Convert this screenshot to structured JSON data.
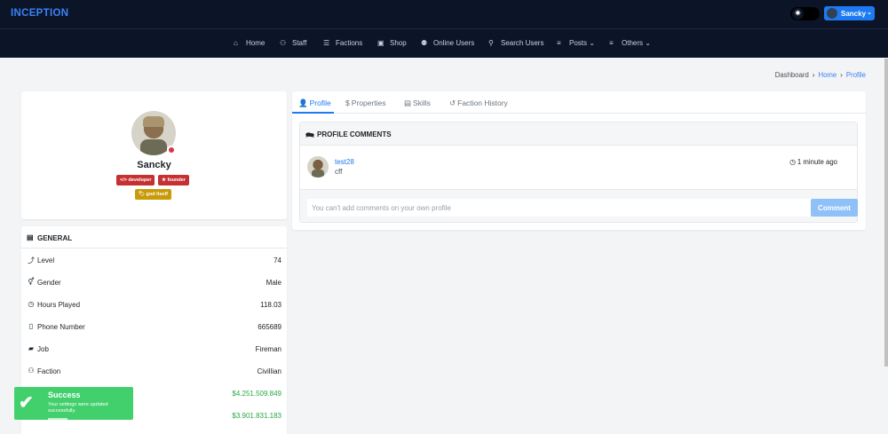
{
  "brand": "INCEPTION",
  "user_menu": {
    "name": "Sancky",
    "chevron": "⌄"
  },
  "theme_toggle": {
    "icon": "sun-icon",
    "glyph": "✷"
  },
  "nav": [
    {
      "label": "Home",
      "icon": "home-icon",
      "glyph": "⌂"
    },
    {
      "label": "Staff",
      "icon": "staff-icon",
      "glyph": "⚇"
    },
    {
      "label": "Factions",
      "icon": "users-icon",
      "glyph": "☰"
    },
    {
      "label": "Shop",
      "icon": "store-icon",
      "glyph": "▣"
    },
    {
      "label": "Online Users",
      "icon": "online-users-icon",
      "glyph": "⚉"
    },
    {
      "label": "Search Users",
      "icon": "search-icon",
      "glyph": "⚲"
    },
    {
      "label": "Posts",
      "icon": "list-icon",
      "glyph": "≡",
      "chevron": "⌄"
    },
    {
      "label": "Others",
      "icon": "list-icon",
      "glyph": "≡",
      "chevron": "⌄"
    }
  ],
  "breadcrumb": {
    "items": [
      "Dashboard",
      "Home",
      "Profile"
    ],
    "separator": "›"
  },
  "profile": {
    "name": "Sancky",
    "status_color": "#dc3545",
    "badges": [
      {
        "label": "developer",
        "glyph": "</>",
        "color": "#c53030"
      },
      {
        "label": "founder",
        "glyph": "★",
        "color": "#c53030"
      },
      {
        "label": "god itself",
        "glyph": "🏷",
        "color": "#c99a0a"
      }
    ]
  },
  "general": {
    "title": "GENERAL",
    "glyph": "▤",
    "rows": [
      {
        "label": "Level",
        "value": "74",
        "icon": "level-icon",
        "glyph": "⤴"
      },
      {
        "label": "Gender",
        "value": "Male",
        "icon": "gender-icon",
        "glyph": "⚥"
      },
      {
        "label": "Hours Played",
        "value": "118.03",
        "icon": "clock-icon",
        "glyph": "◷"
      },
      {
        "label": "Phone Number",
        "value": "665689",
        "icon": "phone-icon",
        "glyph": "▯"
      },
      {
        "label": "Job",
        "value": "Fireman",
        "icon": "briefcase-icon",
        "glyph": "▰"
      },
      {
        "label": "Faction",
        "value": "Civillian",
        "icon": "faction-icon",
        "glyph": "⚇"
      },
      {
        "label": "",
        "value": "$4.251.509.849",
        "icon": "money-icon",
        "glyph": ""
      },
      {
        "label": "",
        "value": "$3.901.831.183",
        "icon": "bank-icon",
        "glyph": ""
      }
    ],
    "money_color": "#28a745"
  },
  "tabs": [
    {
      "label": "Profile",
      "glyph": "👤",
      "active": true
    },
    {
      "label": "Properties",
      "glyph": "$",
      "active": false
    },
    {
      "label": "Skills",
      "glyph": "▤",
      "active": false
    },
    {
      "label": "Faction History",
      "glyph": "↺",
      "active": false
    }
  ],
  "comments": {
    "title": "PROFILE COMMENTS",
    "glyph": "🗪",
    "items": [
      {
        "user": "test28",
        "text": "cff",
        "time": "1 minute ago",
        "glyph": "◷"
      }
    ],
    "input_placeholder": "You can't add comments on your own profile",
    "button_label": "Comment"
  },
  "toast": {
    "title": "Success",
    "message": "Your settings were updated successfully.",
    "glyph": "✔",
    "color": "#42d06c"
  },
  "colors": {
    "accent": "#1d7af3",
    "topbar": "#0c1427",
    "danger": "#c53030",
    "warning": "#c99a0a"
  }
}
